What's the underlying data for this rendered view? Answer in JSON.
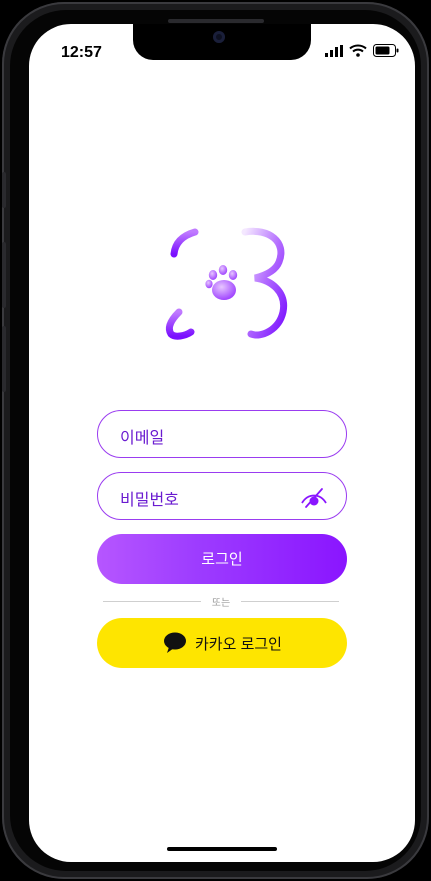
{
  "status_bar": {
    "time": "12:57"
  },
  "colors": {
    "brand_purple": "#8a15ff",
    "field_border": "#9a3cf0",
    "kakao_yellow": "#fee500"
  },
  "login_form": {
    "email_placeholder": "이메일",
    "password_placeholder": "비밀번호",
    "login_button": "로그인",
    "divider_text": "또는",
    "kakao_button": "카카오 로그인"
  },
  "icons": [
    "logo-paw-icon",
    "eye-slash-icon",
    "kakao-chat-bubble-icon",
    "signal-icon",
    "wifi-icon",
    "battery-icon"
  ]
}
